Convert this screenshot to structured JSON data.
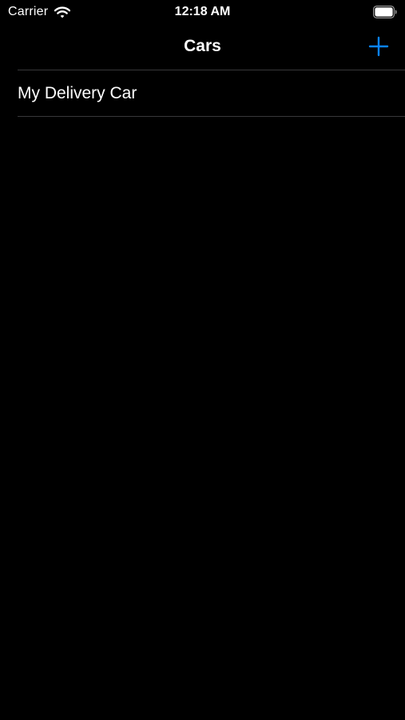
{
  "status_bar": {
    "carrier": "Carrier",
    "time": "12:18 AM",
    "icons": {
      "wifi": "wifi-icon",
      "battery": "battery-icon"
    }
  },
  "nav_bar": {
    "title": "Cars",
    "add_icon": "plus-icon",
    "accent_color": "#0a84ff"
  },
  "cars": {
    "items": [
      {
        "label": "My Delivery Car"
      }
    ]
  },
  "colors": {
    "background": "#000000",
    "text": "#ffffff",
    "separator": "#38383a",
    "accent": "#0a84ff"
  }
}
